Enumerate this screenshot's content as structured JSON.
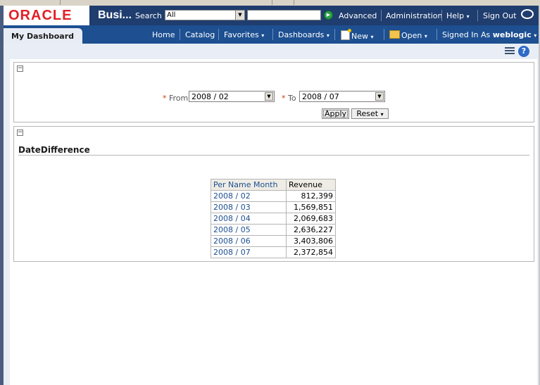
{
  "header": {
    "logo": "ORACLE",
    "app_name": "Busi...",
    "search_label": "Search",
    "search_scope": "All",
    "search_query": "",
    "links": {
      "advanced": "Advanced",
      "administration": "Administration",
      "help": "Help",
      "sign_out": "Sign Out"
    }
  },
  "nav": {
    "dashboard_tab": "My Dashboard",
    "home": "Home",
    "catalog": "Catalog",
    "favorites": "Favorites",
    "dashboards": "Dashboards",
    "new": "New",
    "open": "Open",
    "signed_in_as": "Signed In As",
    "user": "weblogic"
  },
  "prompt": {
    "from_label": "From",
    "from_value": "2008 / 02",
    "to_label": "To",
    "to_value": "2008 / 07",
    "apply_label": "Apply",
    "reset_label": "Reset"
  },
  "report": {
    "title": "DateDifference",
    "columns": [
      "Per Name Month",
      "Revenue"
    ],
    "rows": [
      {
        "month": "2008 / 02",
        "revenue": "812,399"
      },
      {
        "month": "2008 / 03",
        "revenue": "1,569,851"
      },
      {
        "month": "2008 / 04",
        "revenue": "2,069,683"
      },
      {
        "month": "2008 / 05",
        "revenue": "2,636,227"
      },
      {
        "month": "2008 / 06",
        "revenue": "3,403,806"
      },
      {
        "month": "2008 / 07",
        "revenue": "2,372,854"
      }
    ]
  },
  "colors": {
    "header_bg": "#1f3d6e",
    "nav_bg": "#1d4f91",
    "oracle_red": "#e11f26",
    "link_blue": "#1d4f91"
  },
  "icons": [
    "collapse-icon",
    "go-icon",
    "new-icon",
    "open-folder-icon",
    "page-options-icon",
    "help-icon"
  ]
}
